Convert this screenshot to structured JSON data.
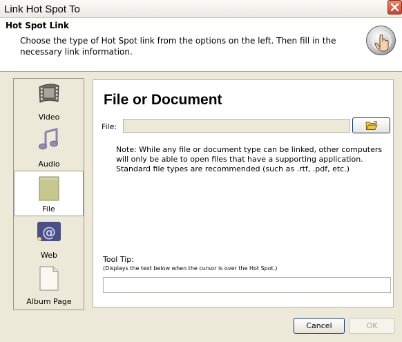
{
  "window": {
    "title": "Link Hot Spot To"
  },
  "header": {
    "title": "Hot Spot Link",
    "description": "Choose the type of Hot Spot link from the options on the left. Then fill in the necessary link information."
  },
  "sidebar": {
    "items": [
      {
        "label": "Video",
        "icon": "video-icon"
      },
      {
        "label": "Audio",
        "icon": "audio-icon"
      },
      {
        "label": "File",
        "icon": "file-icon",
        "selected": true
      },
      {
        "label": "Web",
        "icon": "web-icon"
      },
      {
        "label": "Album Page",
        "icon": "album-page-icon"
      }
    ]
  },
  "panel": {
    "title": "File or Document",
    "file_label": "File:",
    "file_value": "",
    "note": "Note: While any file or document type can be linked, other computers will only be able to open files that have a supporting application. Standard file types are recommended (such as .rtf, .pdf, etc.)",
    "tooltip_label": "Tool Tip:",
    "tooltip_hint": "(Displays the text below when the cursor is over the Hot Spot.)",
    "tooltip_value": ""
  },
  "buttons": {
    "cancel": "Cancel",
    "ok": "OK"
  },
  "colors": {
    "accent": "#003c74",
    "close": "#c7422a"
  }
}
